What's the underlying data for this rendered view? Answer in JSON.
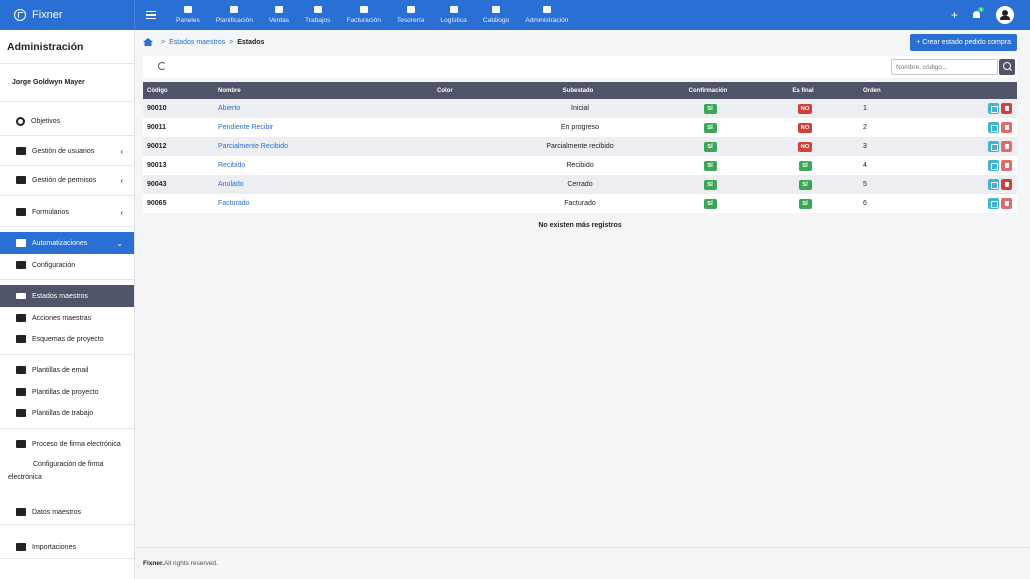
{
  "app": {
    "name": "Fixner"
  },
  "nav": [
    {
      "label": "Paneles",
      "icon": "grid-icon"
    },
    {
      "label": "Planificación",
      "icon": "calendar-icon"
    },
    {
      "label": "Ventas",
      "icon": "handshake-icon"
    },
    {
      "label": "Trabajos",
      "icon": "folder-icon"
    },
    {
      "label": "Facturación",
      "icon": "invoice-icon"
    },
    {
      "label": "Tesorería",
      "icon": "money-icon"
    },
    {
      "label": "Logística",
      "icon": "people-carry-icon"
    },
    {
      "label": "Catálogo",
      "icon": "catalog-icon"
    },
    {
      "label": "Administración",
      "icon": "gear-icon"
    }
  ],
  "topright": {
    "plus": "+",
    "bell_badge": "4"
  },
  "sidebar": {
    "title": "Administración",
    "user": "Jorge Goldwyn Mayer",
    "items": [
      {
        "label": "Objetivos"
      },
      {
        "label": "Gestión de usuarios"
      },
      {
        "label": "Gestión de permisos"
      },
      {
        "label": "Formularios"
      },
      {
        "label": "Automatizaciones"
      },
      {
        "label": "Configuración"
      },
      {
        "label": "Estados maestros"
      },
      {
        "label": "Acciones maestras"
      },
      {
        "label": "Esquemas de proyecto"
      },
      {
        "label": "Plantillas de email"
      },
      {
        "label": "Plantillas de proyecto"
      },
      {
        "label": "Plantillas de trabajo"
      },
      {
        "label": "Proceso de firma electrónica"
      },
      {
        "label": "Configuración de firma electrónica"
      },
      {
        "label": "Datos maestros"
      },
      {
        "label": "Importaciones"
      }
    ]
  },
  "breadcrumb": {
    "sep": ">",
    "parent": "Estados maestros",
    "current": "Estados"
  },
  "create_button": "+ Crear estado pedido compra",
  "search": {
    "placeholder": "Nombre, código..."
  },
  "table": {
    "headers": [
      "Código",
      "Nombre",
      "Color",
      "Subestado",
      "Confirmación",
      "Es final",
      "Orden"
    ],
    "rows": [
      {
        "code": "90010",
        "name": "Abierto",
        "sub": "Inicial",
        "conf": "SÍ",
        "final": "NO",
        "order": "1"
      },
      {
        "code": "90011",
        "name": "Pendiente Recibir",
        "sub": "En progreso",
        "conf": "SÍ",
        "final": "NO",
        "order": "2"
      },
      {
        "code": "90012",
        "name": "Parcialmente Recibido",
        "sub": "Parcialmente recibido",
        "conf": "SÍ",
        "final": "NO",
        "order": "3"
      },
      {
        "code": "90013",
        "name": "Recibido",
        "sub": "Recibido",
        "conf": "SÍ",
        "final": "SÍ",
        "order": "4"
      },
      {
        "code": "90043",
        "name": "Anulado",
        "sub": "Cerrado",
        "conf": "SÍ",
        "final": "SÍ",
        "order": "5"
      },
      {
        "code": "90065",
        "name": "Facturado",
        "sub": "Facturado",
        "conf": "SÍ",
        "final": "SÍ",
        "order": "6"
      }
    ]
  },
  "no_more": "No existen más registros",
  "footer": {
    "brand": "Fixner.",
    "text": " All rights reserved."
  },
  "colors": {
    "primary": "#2a6fd4",
    "header_dark": "#4f5468",
    "yes": "#3aa757",
    "no": "#d43f3a"
  }
}
